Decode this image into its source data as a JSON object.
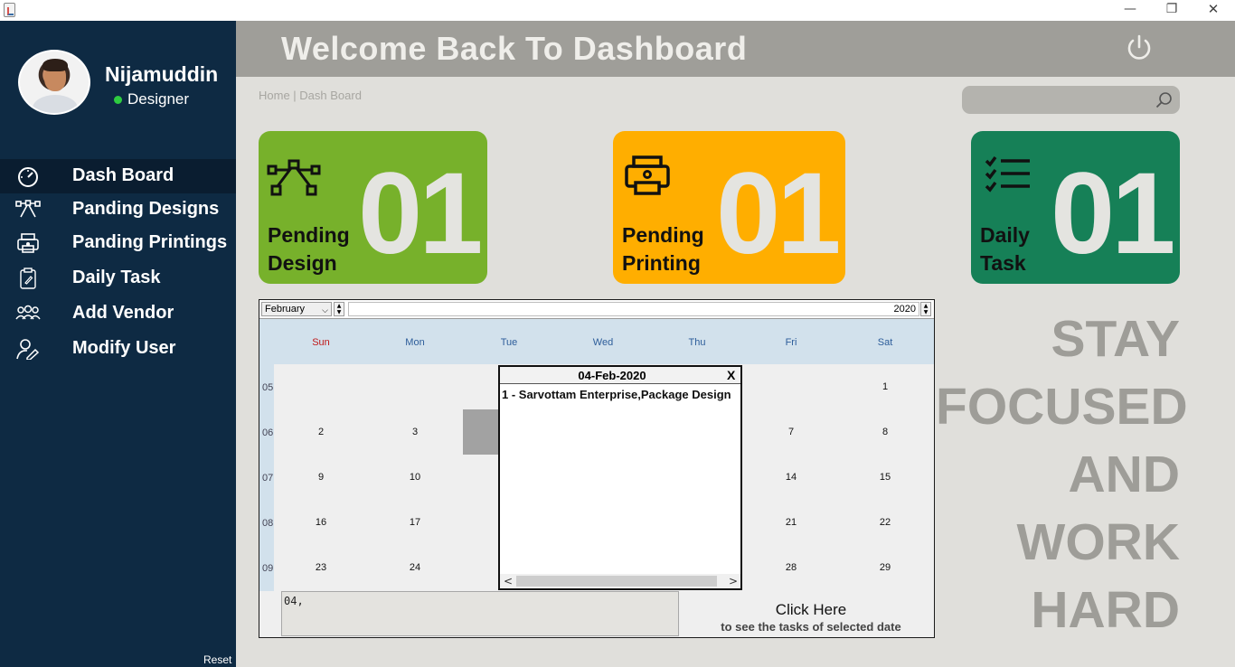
{
  "window": {
    "minimize_glyph": "—",
    "maximize_glyph": "❐",
    "close_glyph": "✕"
  },
  "user": {
    "name": "Nijamuddin",
    "role": "Designer",
    "status_color": "#2ecc40"
  },
  "sidebar": {
    "items": [
      {
        "label": "Dash Board",
        "icon": "speedometer-icon",
        "active": true
      },
      {
        "label": "Panding Designs",
        "icon": "bezier-pen-icon",
        "active": false
      },
      {
        "label": "Panding Printings",
        "icon": "printer-icon",
        "active": false
      },
      {
        "label": "Daily Task",
        "icon": "clipboard-icon",
        "active": false
      },
      {
        "label": "Add Vendor",
        "icon": "users-icon",
        "active": false
      },
      {
        "label": "Modify User",
        "icon": "user-edit-icon",
        "active": false
      }
    ],
    "reset_label": "Reset"
  },
  "header": {
    "title": "Welcome Back To Dashboard",
    "power_icon": "power-icon"
  },
  "breadcrumb": "Home | Dash Board",
  "search": {
    "placeholder": "",
    "value": ""
  },
  "cards": {
    "design": {
      "label_line1": "Pending",
      "label_line2": "Design",
      "value": "01",
      "color": "#77b12b",
      "icon": "bezier-pen-icon"
    },
    "print": {
      "label_line1": "Pending",
      "label_line2": "Printing",
      "value": "01",
      "color": "#ffae00",
      "icon": "printer-icon"
    },
    "task": {
      "label_line1": "Daily",
      "label_line2": "Task",
      "value": "01",
      "color": "#168057",
      "icon": "checklist-icon"
    }
  },
  "calendar": {
    "month": "February",
    "year": "2020",
    "weekdays": [
      "Sun",
      "Mon",
      "Tue",
      "Wed",
      "Thu",
      "Fri",
      "Sat"
    ],
    "week_numbers": [
      "05",
      "06",
      "07",
      "08",
      "09"
    ],
    "days": [
      [
        "",
        "",
        "",
        "",
        "",
        "",
        "1"
      ],
      [
        "2",
        "3",
        "",
        "",
        "",
        "7",
        "8"
      ],
      [
        "9",
        "10",
        "",
        "",
        "",
        "14",
        "15"
      ],
      [
        "16",
        "17",
        "",
        "",
        "",
        "21",
        "22"
      ],
      [
        "23",
        "24",
        "",
        "",
        "",
        "28",
        "29"
      ]
    ],
    "notes_value": "04,",
    "click_here": "Click Here",
    "click_sub": "to see the tasks of selected date"
  },
  "popup": {
    "title": "04-Feb-2020",
    "close_label": "X",
    "entry": "1 - Sarvottam Enterprise,Package Design"
  },
  "motto": [
    "STAY",
    "FOCUSED",
    "AND",
    "WORK",
    "HARD"
  ]
}
